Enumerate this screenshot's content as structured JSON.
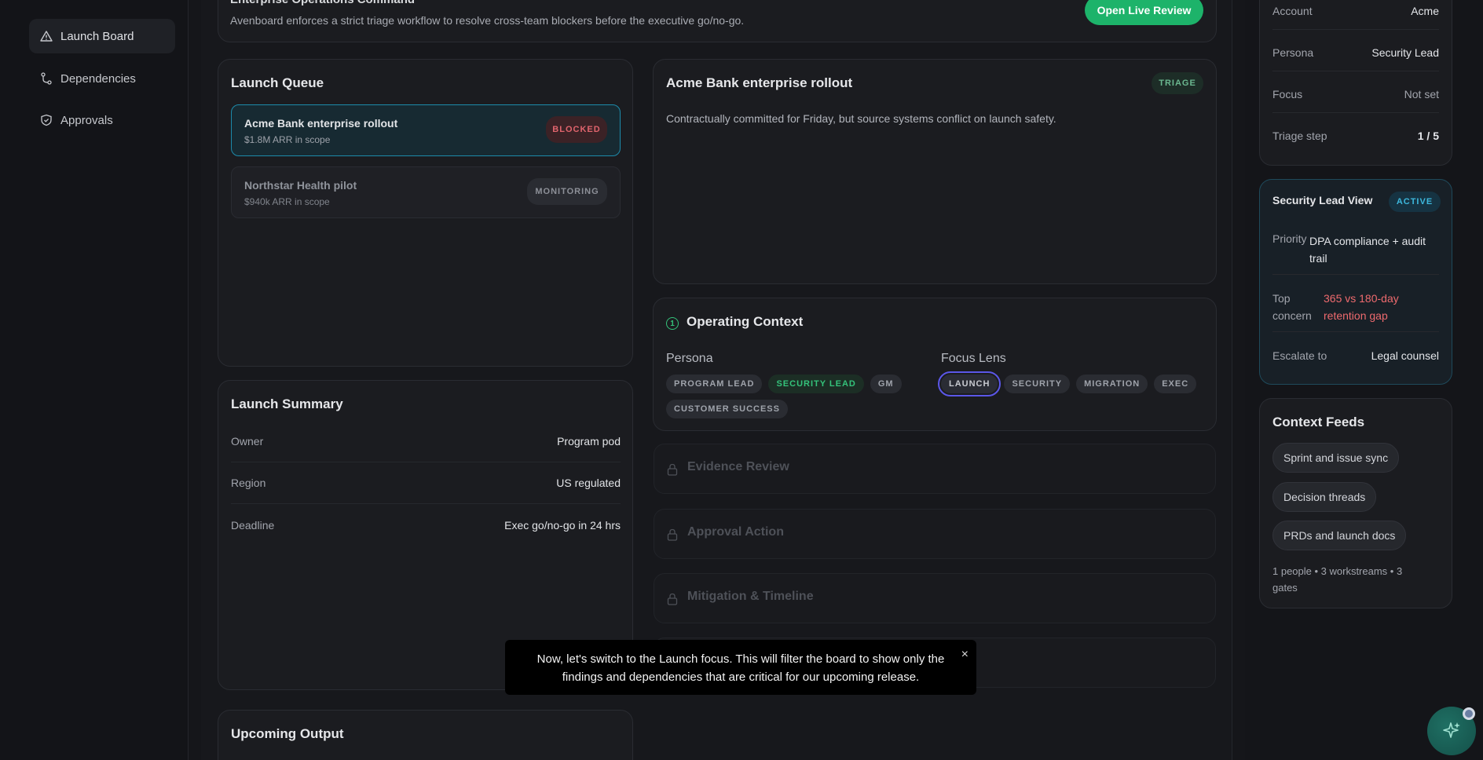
{
  "sidebar": {
    "items": [
      {
        "label": "Launch Board",
        "icon": "warning-triangle-icon"
      },
      {
        "label": "Dependencies",
        "icon": "branch-icon"
      },
      {
        "label": "Approvals",
        "icon": "shield-check-icon"
      }
    ]
  },
  "hero": {
    "title": "Enterprise Operations Command",
    "subtitle": "Avenboard enforces a strict triage workflow to resolve cross-team blockers before the executive go/no-go.",
    "button": "Open Live Review"
  },
  "queue": {
    "title": "Launch Queue",
    "items": [
      {
        "name": "Acme Bank enterprise rollout",
        "sub": "$1.8M ARR in scope",
        "status": "BLOCKED"
      },
      {
        "name": "Northstar Health pilot",
        "sub": "$940k ARR in scope",
        "status": "MONITORING"
      }
    ]
  },
  "summary": {
    "title": "Launch Summary",
    "rows": [
      {
        "k": "Owner",
        "v": "Program pod"
      },
      {
        "k": "Region",
        "v": "US regulated"
      },
      {
        "k": "Deadline",
        "v": "Exec go/no-go in 24 hrs"
      }
    ]
  },
  "upcoming": {
    "title": "Upcoming Output"
  },
  "detail": {
    "title": "Acme Bank enterprise rollout",
    "badge": "TRIAGE",
    "description": "Contractually committed for Friday, but source systems conflict on launch safety."
  },
  "context": {
    "step": "1",
    "title": "Operating Context",
    "persona_label": "Persona",
    "personas": [
      "PROGRAM LEAD",
      "SECURITY LEAD",
      "GM",
      "CUSTOMER SUCCESS"
    ],
    "focus_label": "Focus Lens",
    "focus": [
      "LAUNCH",
      "SECURITY",
      "MIGRATION",
      "EXEC"
    ]
  },
  "locked_sections": [
    "Evidence Review",
    "Approval Action",
    "Mitigation & Timeline"
  ],
  "account_card": {
    "rows": [
      {
        "k": "Account",
        "v": "Acme"
      },
      {
        "k": "Persona",
        "v": "Security Lead"
      },
      {
        "k": "Focus",
        "v": "Not set"
      },
      {
        "k": "Triage step",
        "v": "1 / 5"
      }
    ]
  },
  "persona_view": {
    "title": "Security Lead View",
    "badge": "ACTIVE",
    "priority_k": "Priority",
    "priority_v": "DPA compliance + audit trail",
    "concern_k": "Top concern",
    "concern_v": "365 vs 180-day retention gap",
    "escalate_k": "Escalate to",
    "escalate_v": "Legal counsel"
  },
  "feeds": {
    "title": "Context Feeds",
    "items": [
      "Sprint and issue sync",
      "Decision threads",
      "PRDs and launch docs"
    ],
    "footer": "1 people • 3 workstreams • 3 gates"
  },
  "tooltip": {
    "text": "Now, let's switch to the Launch focus. This will filter the board to show only the findings and dependencies that are critical for our upcoming release.",
    "close": "×"
  },
  "colors": {
    "accent_green": "#1db36a",
    "selected_border": "#1d8bab",
    "blocked_red": "#e0646d",
    "focus_ring": "#5b57e8"
  }
}
